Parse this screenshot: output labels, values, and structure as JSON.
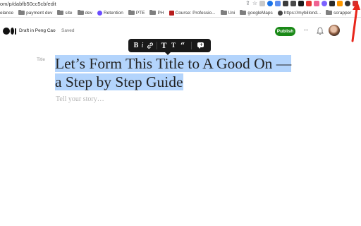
{
  "browser": {
    "url": "om/p/dabfb50cc5cb/edit",
    "bookmarks": [
      {
        "label": "elance",
        "icon": "none"
      },
      {
        "label": "payment dev",
        "icon": "folder-icon"
      },
      {
        "label": "site",
        "icon": "folder-icon"
      },
      {
        "label": "dev",
        "icon": "folder-icon"
      },
      {
        "label": "Retention",
        "icon": "dot-icon"
      },
      {
        "label": "PTE",
        "icon": "folder-icon"
      },
      {
        "label": "PH",
        "icon": "folder-icon"
      },
      {
        "label": "Course: Professio...",
        "icon": "course-icon"
      },
      {
        "label": "Uni",
        "icon": "folder-icon"
      },
      {
        "label": "googleMaps",
        "icon": "folder-icon"
      },
      {
        "label": "https://mybillond...",
        "icon": "globe-icon"
      },
      {
        "label": "scrapper",
        "icon": "folder-icon"
      }
    ]
  },
  "header": {
    "draft_label": "Draft in Peng Cao",
    "saved_label": "Saved",
    "publish_label": "Publish",
    "more_label": "···"
  },
  "toolbar": {
    "bold": "B",
    "italic": "i",
    "link": "🔗",
    "title_large": "T",
    "title_small": "T",
    "quote": "“",
    "comment_plus": "+"
  },
  "editor": {
    "title_tag": "Title",
    "title_line1": "Let’s Form This Title to A Good On —",
    "title_line2": "a Step by Step Guide",
    "placeholder": "Tell your story…"
  },
  "colors": {
    "publish_green": "#1a8917",
    "selection": "#b3d4fc",
    "toolbar_bg": "#191919",
    "annotation_red": "#e8261b"
  }
}
